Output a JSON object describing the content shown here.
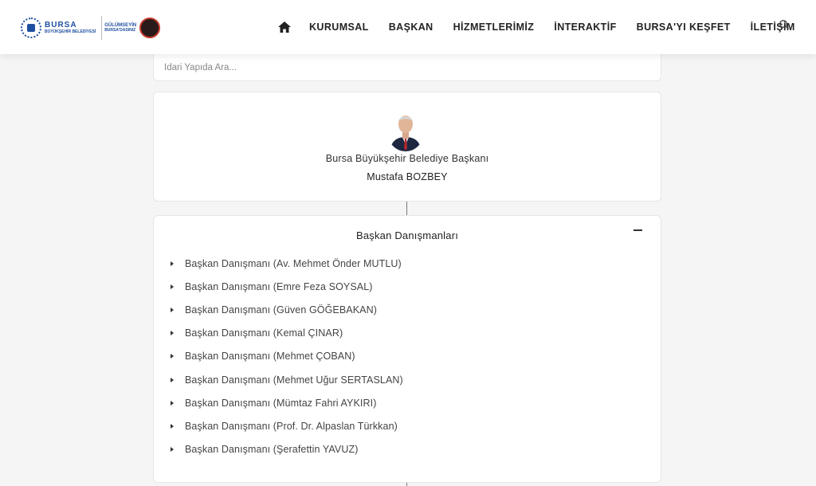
{
  "logo": {
    "brand": "BURSA",
    "sub": "BÜYÜKŞEHİR BELEDİYESİ",
    "slogan_line1": "GÜLÜMSEYİN",
    "slogan_line2": "BURSA'DASINIZ"
  },
  "nav": {
    "items": [
      {
        "label": "KURUMSAL"
      },
      {
        "label": "BAŞKAN"
      },
      {
        "label": "HİZMETLERİMİZ"
      },
      {
        "label": "İNTERAKTİF"
      },
      {
        "label": "BURSA'YI KEŞFET"
      },
      {
        "label": "İLETİŞİM"
      }
    ]
  },
  "search": {
    "placeholder": "İdari Yapıda Ara..."
  },
  "mayor": {
    "title": "Bursa Büyükşehir Belediye Başkanı",
    "name": "Mustafa BOZBEY"
  },
  "advisors": {
    "title": "Başkan Danışmanları",
    "items": [
      {
        "label": "Başkan Danışmanı (Av. Mehmet Önder MUTLU)"
      },
      {
        "label": "Başkan Danışmanı (Emre Feza SOYSAL)"
      },
      {
        "label": "Başkan Danışmanı (Güven GÖĞEBAKAN)"
      },
      {
        "label": "Başkan Danışmanı (Kemal ÇINAR)"
      },
      {
        "label": "Başkan Danışmanı (Mehmet ÇOBAN)"
      },
      {
        "label": "Başkan Danışmanı (Mehmet Uğur SERTASLAN)"
      },
      {
        "label": "Başkan Danışmanı (Mümtaz Fahri AYKIRI)"
      },
      {
        "label": "Başkan Danışmanı (Prof. Dr. Alpaslan Türkkan)"
      },
      {
        "label": "Başkan Danışmanı (Şerafettin YAVUZ)"
      }
    ]
  },
  "colors": {
    "brand_blue": "#1f4fa0",
    "page_bg": "#f5f5f5"
  }
}
